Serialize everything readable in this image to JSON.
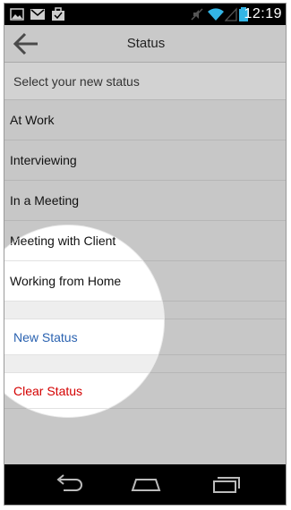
{
  "status_bar": {
    "time": "12:19",
    "icons": [
      "image-icon",
      "mail-icon",
      "briefcase-icon",
      "mute-icon",
      "wifi-icon",
      "signal-icon",
      "battery-icon"
    ]
  },
  "action_bar": {
    "title": "Status",
    "back_icon": "back-arrow-icon"
  },
  "list": {
    "header": "Select your new status",
    "statuses": [
      "At Work",
      "Interviewing",
      "In a Meeting",
      "Meeting with Client",
      "Working from Home"
    ],
    "new_status_label": "New Status",
    "clear_status_label": "Clear Status"
  },
  "nav_bar": {
    "icons": [
      "back-nav-icon",
      "home-nav-icon",
      "recent-apps-icon"
    ]
  },
  "colors": {
    "blue_link": "#2a62b0",
    "red_link": "#d40000",
    "background": "#c7c7c7"
  }
}
